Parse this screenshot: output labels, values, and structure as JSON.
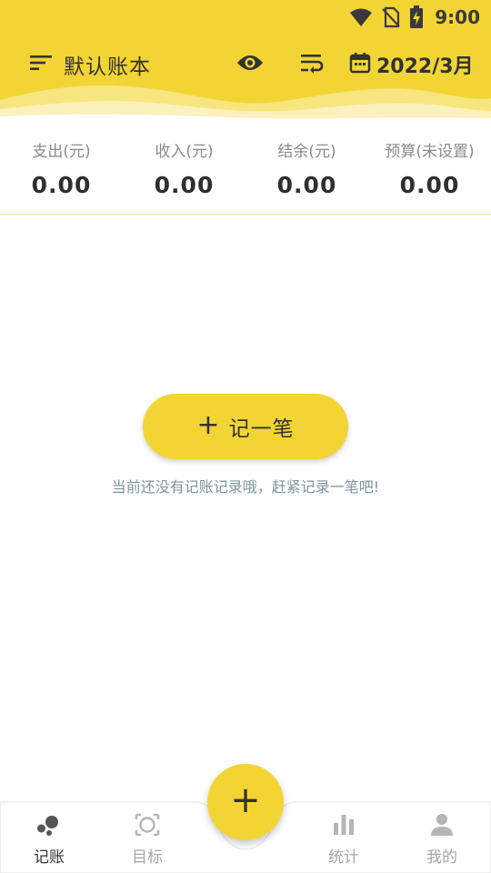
{
  "status_bar": {
    "time": "9:00",
    "icons": [
      "wifi-icon",
      "no-sim-icon",
      "battery-charging-icon"
    ]
  },
  "header": {
    "menu_icon": "sort-lines-icon",
    "book_title": "默认账本",
    "visibility_icon": "eye-icon",
    "sort_icon": "wrap-sort-icon",
    "calendar_icon": "calendar-icon",
    "date": "2022/3月"
  },
  "summary": [
    {
      "label": "支出(元)",
      "value": "0.00"
    },
    {
      "label": "收入(元)",
      "value": "0.00"
    },
    {
      "label": "结余(元)",
      "value": "0.00"
    },
    {
      "label": "预算(未设置)",
      "value": "0.00"
    }
  ],
  "empty_state": {
    "button_icon": "plus-icon",
    "button_label": "记一笔",
    "hint": "当前还没有记账记录哦，赶紧记录一笔吧!"
  },
  "bottom_nav": {
    "items": [
      {
        "label": "记账",
        "icon": "bubbles-icon",
        "active": true
      },
      {
        "label": "目标",
        "icon": "target-frame-icon",
        "active": false
      },
      {
        "label": "统计",
        "icon": "bar-chart-icon",
        "active": false
      },
      {
        "label": "我的",
        "icon": "person-icon",
        "active": false
      }
    ],
    "fab_icon": "plus-icon"
  },
  "colors": {
    "accent": "#F2D534",
    "text_dark": "#333333",
    "text_muted": "#8a8a8a",
    "hint": "#7f95a0",
    "nav_inactive": "#a6a6a6"
  }
}
